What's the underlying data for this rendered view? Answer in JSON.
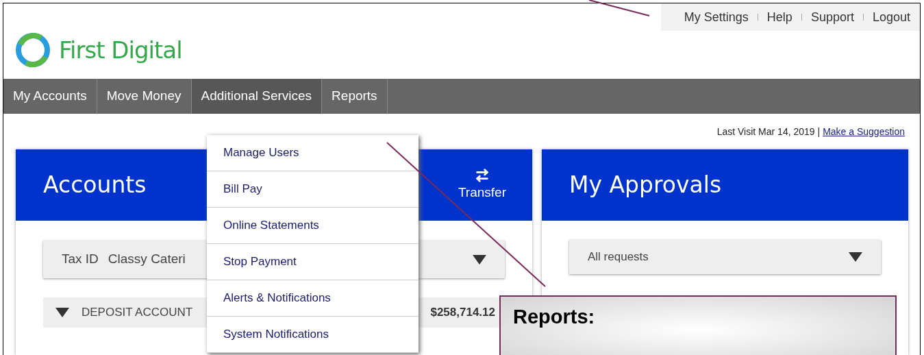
{
  "utility_links": [
    "My Settings",
    "Help",
    "Support",
    "Logout"
  ],
  "logo": {
    "text": "First Digital"
  },
  "nav": [
    {
      "label": "My Accounts",
      "selected": false
    },
    {
      "label": "Move Money",
      "selected": false
    },
    {
      "label": "Additional Services",
      "selected": true
    },
    {
      "label": "Reports",
      "selected": false
    }
  ],
  "dropdown": {
    "items": [
      "Manage Users",
      "Bill Pay",
      "Online Statements",
      "Stop Payment",
      "Alerts & Notifications",
      "System Notifications"
    ]
  },
  "last_visit": {
    "text": "Last Visit Mar 14, 2019 |",
    "link": "Make a Suggestion"
  },
  "accounts_card": {
    "title": "Accounts",
    "action": "Transfer",
    "filter": {
      "label": "Tax ID",
      "value": "Classy Cateri"
    },
    "group_row": {
      "name": "DEPOSIT ACCOUNT",
      "total": "$258,714.12",
      "expanded": true
    }
  },
  "approvals_card": {
    "title": "My Approvals",
    "filter": {
      "value": "All requests"
    }
  },
  "callout": {
    "title": "Reports:"
  }
}
